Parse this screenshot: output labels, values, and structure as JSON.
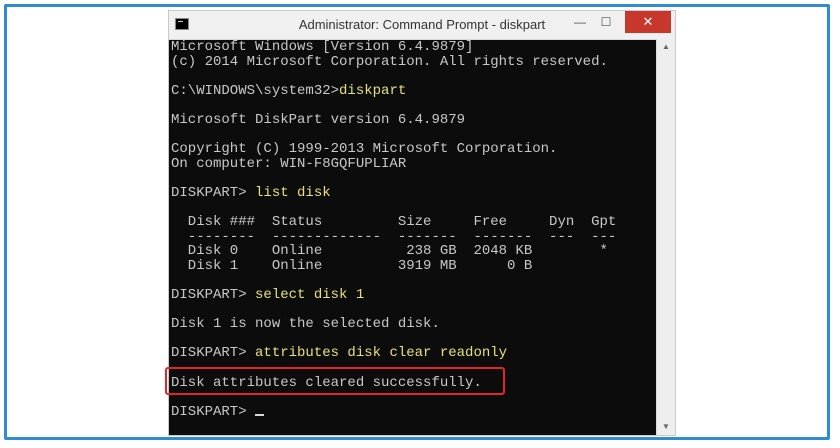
{
  "window": {
    "title": "Administrator: Command Prompt - diskpart",
    "min_symbol": "—",
    "max_symbol": "☐",
    "close_symbol": "✕",
    "icon": "cmd-icon"
  },
  "console": {
    "lines": [
      {
        "text": "Microsoft Windows [Version 6.4.9879]"
      },
      {
        "text": "(c) 2014 Microsoft Corporation. All rights reserved."
      },
      {
        "text": ""
      },
      {
        "prompt": "C:\\WINDOWS\\system32>",
        "cmd": "diskpart"
      },
      {
        "text": ""
      },
      {
        "text": "Microsoft DiskPart version 6.4.9879"
      },
      {
        "text": ""
      },
      {
        "text": "Copyright (C) 1999-2013 Microsoft Corporation."
      },
      {
        "text": "On computer: WIN-F8GQFUPLIAR"
      },
      {
        "text": ""
      },
      {
        "prompt": "DISKPART> ",
        "cmd": "list disk"
      },
      {
        "text": ""
      },
      {
        "text": "  Disk ###  Status         Size     Free     Dyn  Gpt"
      },
      {
        "text": "  --------  -------------  -------  -------  ---  ---"
      },
      {
        "text": "  Disk 0    Online          238 GB  2048 KB        *"
      },
      {
        "text": "  Disk 1    Online         3919 MB      0 B"
      },
      {
        "text": ""
      },
      {
        "prompt": "DISKPART> ",
        "cmd": "select disk 1"
      },
      {
        "text": ""
      },
      {
        "text": "Disk 1 is now the selected disk."
      },
      {
        "text": ""
      },
      {
        "prompt": "DISKPART> ",
        "cmd": "attributes disk clear readonly"
      },
      {
        "text": ""
      },
      {
        "text": "Disk attributes cleared successfully."
      },
      {
        "text": ""
      },
      {
        "prompt": "DISKPART> ",
        "cmd": "",
        "cursor": true
      }
    ]
  },
  "colors": {
    "console_bg": "#0c0c0c",
    "console_text": "#c8c8c8",
    "command_text": "#e6e27a",
    "highlight_box": "#e1252a",
    "outer_frame": "#2f8ccf"
  }
}
